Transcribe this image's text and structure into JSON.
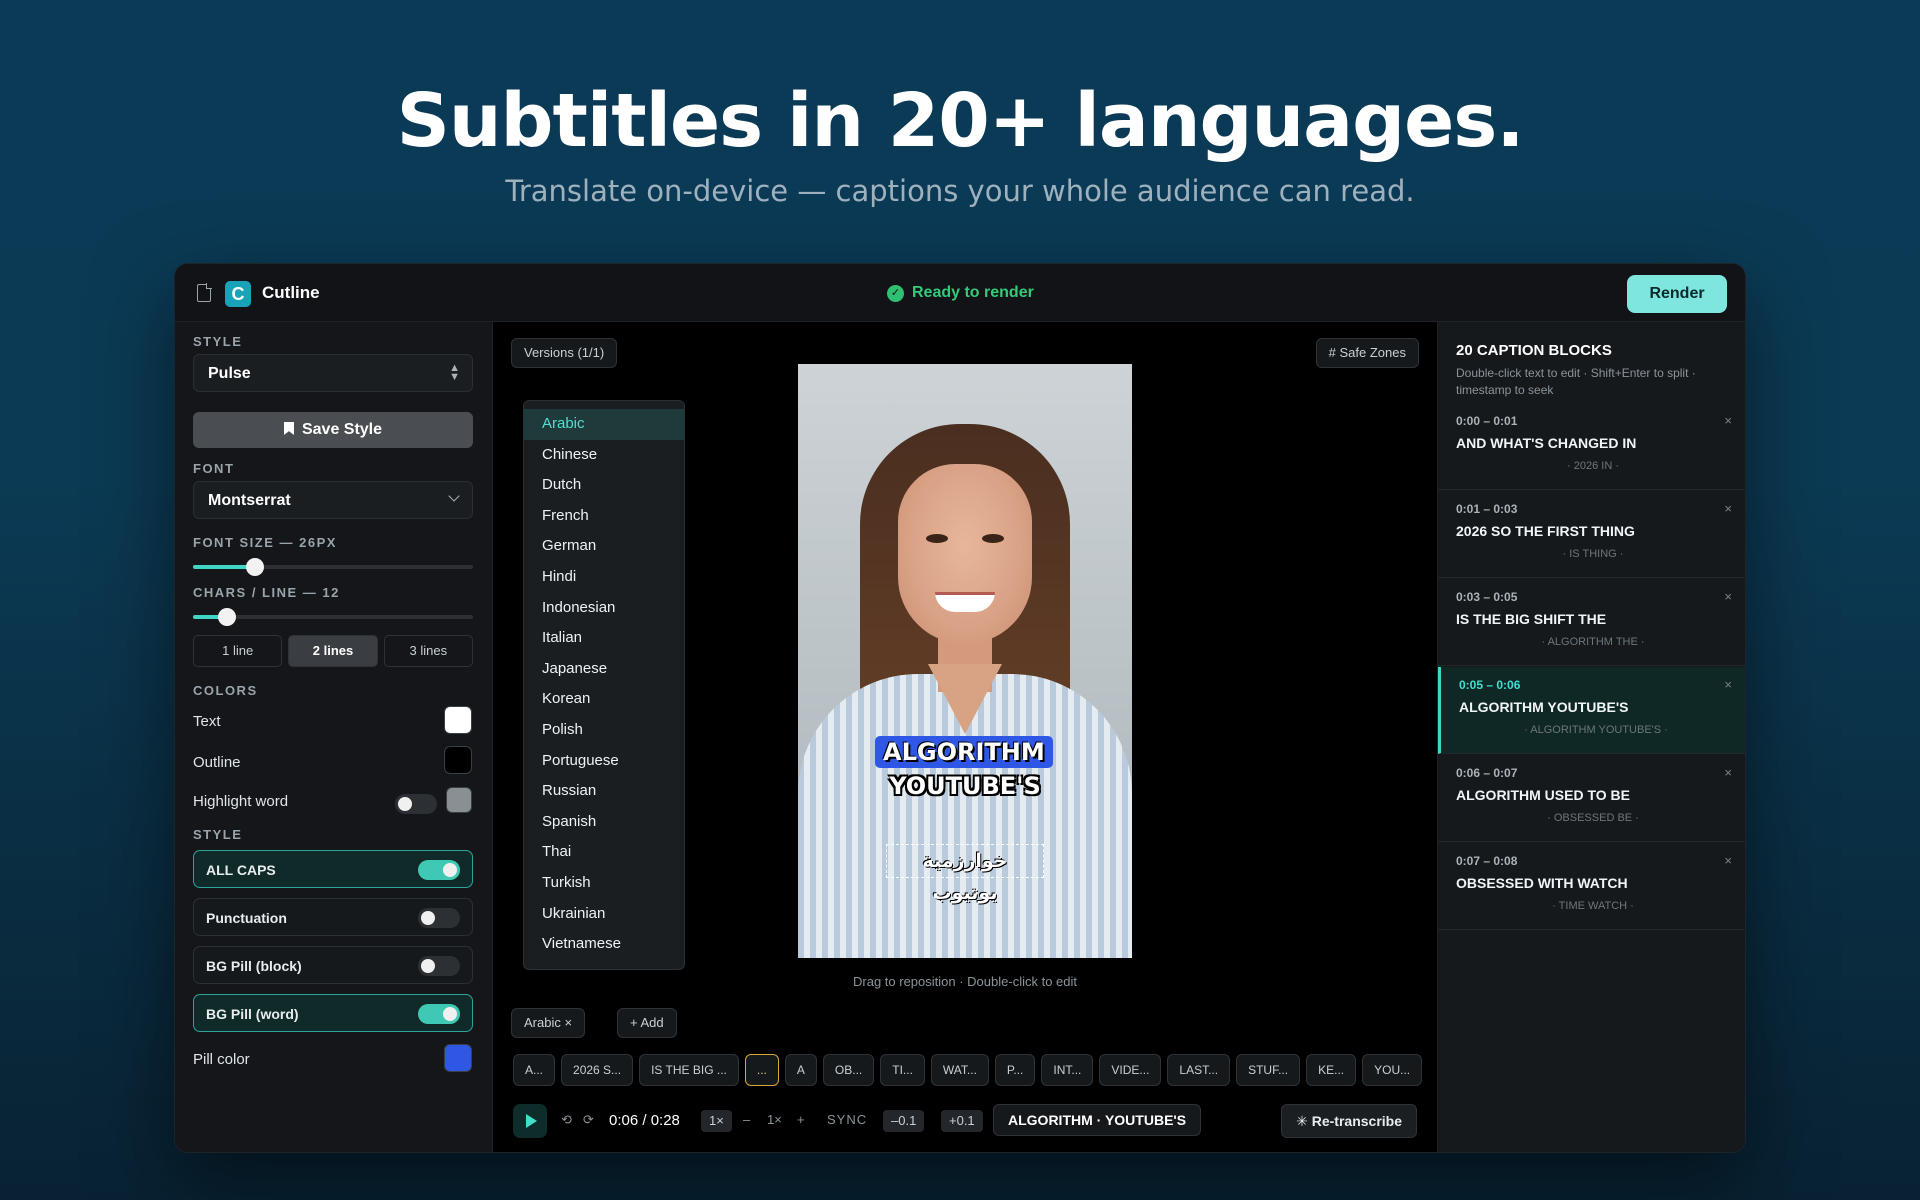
{
  "hero": {
    "title": "Subtitles in 20+ languages.",
    "subtitle": "Translate on-device — captions your whole audience can read."
  },
  "topbar": {
    "app_name": "Cutline",
    "logo_letter": "C",
    "status": "Ready to render",
    "render_label": "Render"
  },
  "left": {
    "style_section": "STYLE",
    "style_value": "Pulse",
    "save_style": "Save Style",
    "font_section": "FONT",
    "font_value": "Montserrat",
    "font_size_label": "FONT SIZE — 26PX",
    "font_size_level": 0.22,
    "chars_label": "CHARS / LINE — 12",
    "chars_level": 0.12,
    "lines": [
      "1 line",
      "2 lines",
      "3 lines"
    ],
    "lines_active": "2 lines",
    "colors_section": "COLORS",
    "text_label": "Text",
    "text_color": "#ffffff",
    "outline_label": "Outline",
    "outline_color": "#000000",
    "highlight_label": "Highlight word",
    "highlight_color": "#8a8f94",
    "style2_section": "STYLE",
    "options": [
      {
        "label": "ALL CAPS",
        "on": true
      },
      {
        "label": "Punctuation",
        "on": false
      },
      {
        "label": "BG Pill (block)",
        "on": false
      },
      {
        "label": "BG Pill (word)",
        "on": true
      }
    ],
    "pill_color_label": "Pill color",
    "pill_color": "#2e57e6"
  },
  "center": {
    "versions": "Versions (1/1)",
    "safe_zones": "# Safe Zones",
    "languages": [
      "Arabic",
      "Chinese",
      "Dutch",
      "French",
      "German",
      "Hindi",
      "Indonesian",
      "Italian",
      "Japanese",
      "Korean",
      "Polish",
      "Portuguese",
      "Russian",
      "Spanish",
      "Thai",
      "Turkish",
      "Ukrainian",
      "Vietnamese"
    ],
    "selected_language": "Arabic",
    "caption_line1": "ALGORITHM",
    "caption_line2": "YOUTUBE'S",
    "arabic_caption": "خوارزمية يوتيوب",
    "hint": "Drag to reposition · Double-click to edit",
    "lang_chip": "Arabic ×",
    "add_chip": "+ Add",
    "caption_chips": [
      "A...",
      "2026 S...",
      "IS THE BIG ...",
      "...",
      "A",
      "OB...",
      "TI...",
      "WAT...",
      "P...",
      "INT...",
      "VIDE...",
      "LAST...",
      "STUF...",
      "KE...",
      "YOU..."
    ],
    "current_chip_index": 3
  },
  "transport": {
    "back_icon": "⟲",
    "fwd_icon": "⟳",
    "time": "0:06 / 0:28",
    "speed": "1×",
    "minus": "–",
    "zoom": "1×",
    "plus": "+",
    "sync_label": "SYNC",
    "sync_minus": "–0.1",
    "sync_plus": "+0.1",
    "segment": "ALGORITHM · YOUTUBE'S",
    "retranscribe": "✳ Re-transcribe"
  },
  "right": {
    "title": "20 CAPTION BLOCKS",
    "desc": "Double-click text to edit · Shift+Enter to split · timestamp to seek",
    "blocks": [
      {
        "time": "0:00 – 0:01",
        "text": "AND WHAT'S CHANGED IN",
        "sub": "· 2026 IN ·"
      },
      {
        "time": "0:01 – 0:03",
        "text": "2026 SO THE FIRST THING",
        "sub": "· IS THING ·"
      },
      {
        "time": "0:03 – 0:05",
        "text": "IS THE BIG SHIFT THE",
        "sub": "· ALGORITHM THE ·"
      },
      {
        "time": "0:05 – 0:06",
        "text": "ALGORITHM YOUTUBE'S",
        "sub": "· ALGORITHM YOUTUBE'S ·"
      },
      {
        "time": "0:06 – 0:07",
        "text": "ALGORITHM USED TO BE",
        "sub": "· OBSESSED BE ·"
      },
      {
        "time": "0:07 – 0:08",
        "text": "OBSESSED WITH WATCH",
        "sub": "· TIME WATCH ·"
      }
    ],
    "active_block": 3
  }
}
